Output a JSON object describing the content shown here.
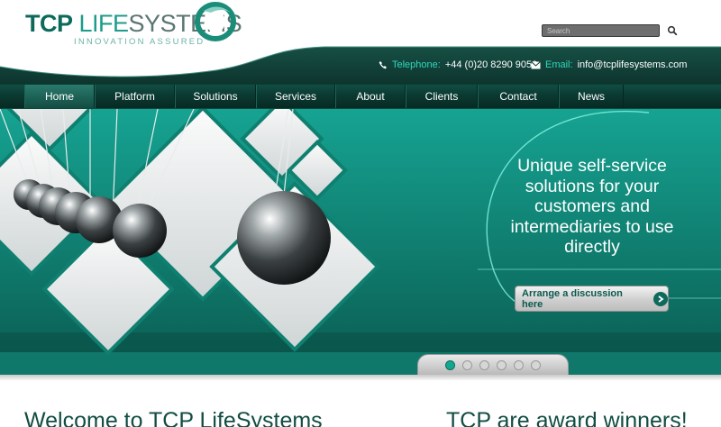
{
  "brand": {
    "name_part1": "TCP",
    "name_part2": "LIFE",
    "name_part3": "SYSTEMS",
    "tagline": "INNOVATION ASSURED"
  },
  "search": {
    "placeholder": "Search"
  },
  "contact": {
    "phone_label": "Telephone:",
    "phone_value": "+44 (0)20 8290 9050",
    "email_label": "Email:",
    "email_value": "info@tcplifesystems.com"
  },
  "nav": {
    "items": [
      {
        "label": "Home"
      },
      {
        "label": "Platform"
      },
      {
        "label": "Solutions"
      },
      {
        "label": "Services"
      },
      {
        "label": "About"
      },
      {
        "label": "Clients"
      },
      {
        "label": "Contact"
      },
      {
        "label": "News"
      }
    ]
  },
  "hero": {
    "headline": "Unique self-service solutions for your customers and intermediaries to use directly",
    "cta_label": "Arrange a discussion here",
    "slides": 6,
    "active_slide": 1
  },
  "sections": {
    "left_heading": "Welcome to TCP LifeSystems",
    "right_heading": "TCP are award winners!"
  },
  "colors": {
    "brand_dark": "#0c6a5b",
    "accent": "#30d8bd",
    "nav_bg": "#0b3a32"
  }
}
